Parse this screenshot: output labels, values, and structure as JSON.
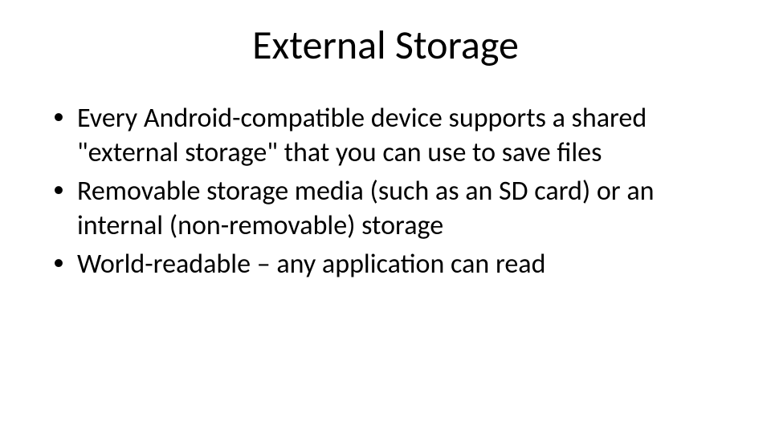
{
  "slide": {
    "title": "External Storage",
    "bullets": [
      "Every Android-compatible device supports a shared \"external storage\" that you can use to save files",
      "Removable storage media (such as an SD card) or an internal (non-removable) storage",
      "World-readable – any application can read"
    ]
  }
}
